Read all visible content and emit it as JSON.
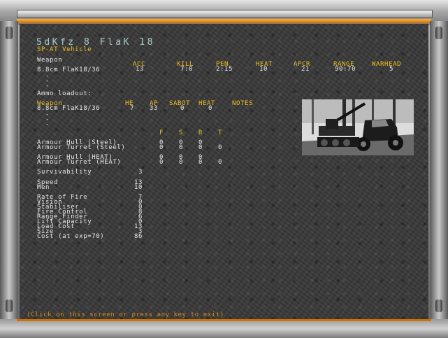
{
  "title": "SdKfz 8 FlaK 18",
  "subtitle": "SP-AT Vehicle",
  "weapon_header": {
    "label": "Weapon",
    "cols": [
      "ACC",
      "KILL",
      "PEN",
      "HEAT",
      "APCR",
      "RANGE",
      "WARHEAD"
    ]
  },
  "weapons": [
    {
      "name": "8.8cm FlaK18/36",
      "acc": "13",
      "kill": "7:0",
      "pen": "2:15",
      "heat": "10",
      "apcr": "21",
      "range": "90:70",
      "warhead": "5"
    }
  ],
  "weapon_blanks": [
    "-",
    "-",
    "-"
  ],
  "ammo": {
    "label": "Ammo loadout:",
    "cols": [
      "Weapon",
      "HE",
      "AP",
      "SABOT",
      "HEAT",
      "NOTES"
    ],
    "rows": [
      {
        "weapon": "8.8cm FlaK18/36",
        "he": "7",
        "ap": "33",
        "sabot": "0",
        "heat": "0",
        "notes": ""
      }
    ],
    "blanks": [
      "-",
      "-",
      "-"
    ]
  },
  "armour": {
    "cols": [
      "F",
      "S",
      "R",
      "T"
    ],
    "rows": [
      {
        "label": "Armour Hull (Steel)",
        "f": "0",
        "s": "0",
        "r": "0",
        "t": ""
      },
      {
        "label": "Armour Turret (Steel)",
        "f": "0",
        "s": "0",
        "r": "0",
        "t": "0"
      },
      {
        "label": "Armour Hull (HEAT)",
        "f": "0",
        "s": "0",
        "r": "0",
        "t": ""
      },
      {
        "label": "Armour Turret (HEAT)",
        "f": "0",
        "s": "0",
        "r": "0",
        "t": "0"
      }
    ]
  },
  "survivability": {
    "label": "Survivability",
    "value": "3"
  },
  "mobility": [
    {
      "label": "Speed",
      "value": "13"
    },
    {
      "label": "Men",
      "value": "10"
    }
  ],
  "stats": [
    {
      "label": "Rate of Fire",
      "value": "7"
    },
    {
      "label": "Vision",
      "value": "0"
    },
    {
      "label": "Stabiliser",
      "value": "0"
    },
    {
      "label": "Fire Control",
      "value": "8"
    },
    {
      "label": "Range Finder",
      "value": "6"
    },
    {
      "label": "Lift Capacity",
      "value": "0"
    },
    {
      "label": "Load Cost",
      "value": "13"
    },
    {
      "label": "Size",
      "value": "3"
    },
    {
      "label": "Cost (at exp=70)",
      "value": "86"
    }
  ],
  "exit_hint": "(Click on this screen or press any key to exit)"
}
